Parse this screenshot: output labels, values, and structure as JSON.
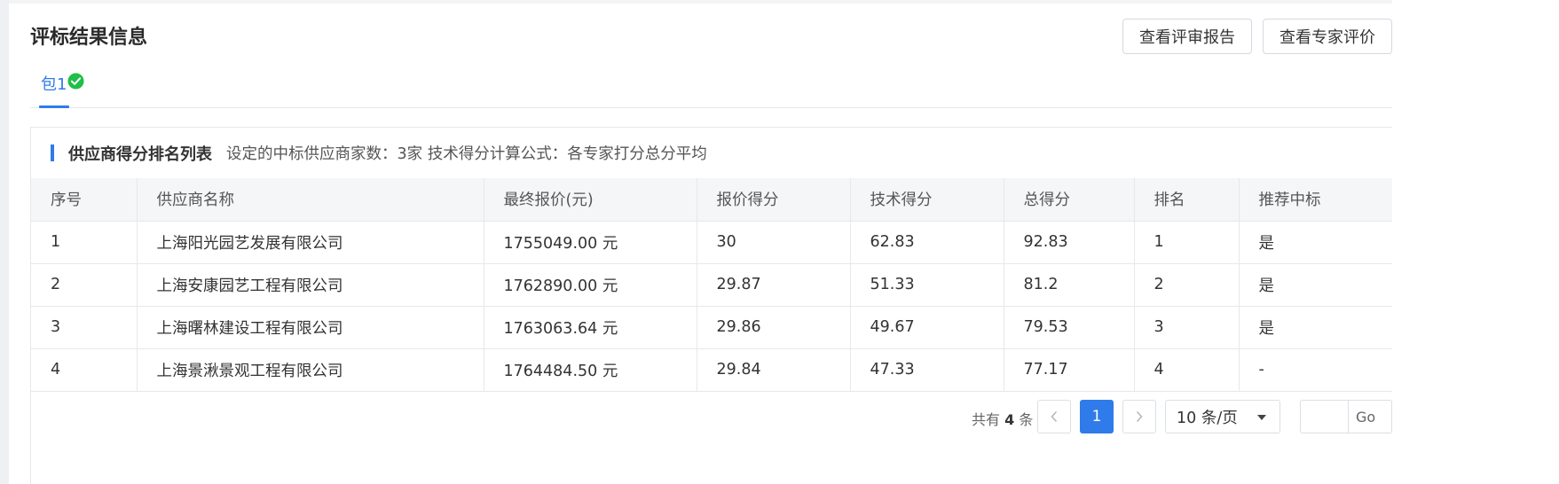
{
  "page": {
    "title": "评标结果信息"
  },
  "actions": {
    "view_report": "查看评审报告",
    "view_expert": "查看专家评价"
  },
  "tabs": [
    {
      "label": "包1",
      "icon": "check-circle-icon",
      "active": true
    }
  ],
  "section": {
    "title": "供应商得分排名列表",
    "description": "设定的中标供应商家数：3家 技术得分计算公式：各专家打分总分平均"
  },
  "table": {
    "columns": [
      "序号",
      "供应商名称",
      "最终报价(元)",
      "报价得分",
      "技术得分",
      "总得分",
      "排名",
      "推荐中标"
    ],
    "rows": [
      [
        "1",
        "上海阳光园艺发展有限公司",
        "1755049.00 元",
        "30",
        "62.83",
        "92.83",
        "1",
        "是"
      ],
      [
        "2",
        "上海安康园艺工程有限公司",
        "1762890.00 元",
        "29.87",
        "51.33",
        "81.2",
        "2",
        "是"
      ],
      [
        "3",
        "上海曙林建设工程有限公司",
        "1763063.64 元",
        "29.86",
        "49.67",
        "79.53",
        "3",
        "是"
      ],
      [
        "4",
        "上海景湫景观工程有限公司",
        "1764484.50 元",
        "29.84",
        "47.33",
        "77.17",
        "4",
        "-"
      ]
    ]
  },
  "pagination": {
    "total_prefix": "共有",
    "total": "4",
    "total_suffix": "条",
    "prev_icon": "chevron-left-icon",
    "next_icon": "chevron-right-icon",
    "current_page": "1",
    "page_size": "10 条/页",
    "jump_value": "",
    "go_label": "Go"
  },
  "colors": {
    "accent": "#2f7bea",
    "success": "#1fbf4a",
    "header_bg": "#f5f6f7",
    "border": "#e6e8eb"
  }
}
